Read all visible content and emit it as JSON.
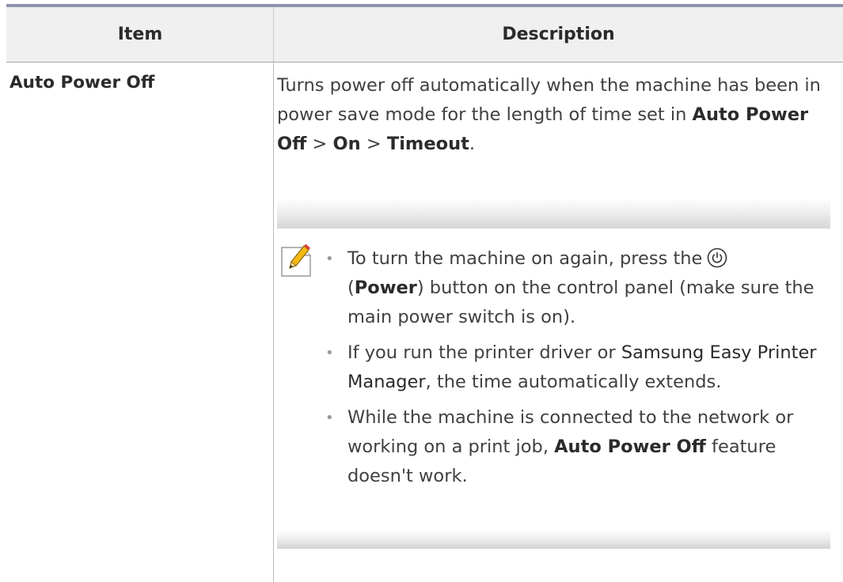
{
  "table": {
    "headers": {
      "item": "Item",
      "description": "Description"
    },
    "row": {
      "item": "Auto Power Off",
      "desc_text_1": "Turns power off automatically when the machine has been in power save mode for the length of time set in ",
      "path_1": "Auto Power Off",
      "sep_1": " > ",
      "path_2": "On",
      "sep_2": " > ",
      "path_3": "Timeout",
      "period": "."
    }
  },
  "note": {
    "icon": "note-pencil-icon",
    "bullets": {
      "b1": {
        "text_1": "To turn the machine on again, press the",
        "power_icon": "power-icon",
        "text_2": " (",
        "bold": "Power",
        "text_3": ") button on the control panel (make sure the main power switch is on)."
      },
      "b2": {
        "text_1": "If you run the printer driver or ",
        "link": "Samsung Easy Printer Manager",
        "text_2": ", the time automatically extends."
      },
      "b3": {
        "text_1": "While the machine is connected to the network or working on a print job, ",
        "bold": "Auto Power Off",
        "text_2": " feature doesn't work."
      }
    }
  },
  "colors": {
    "top_rule": "#8f93ad",
    "header_bg": "#f0f0f0",
    "text": "#404040"
  }
}
